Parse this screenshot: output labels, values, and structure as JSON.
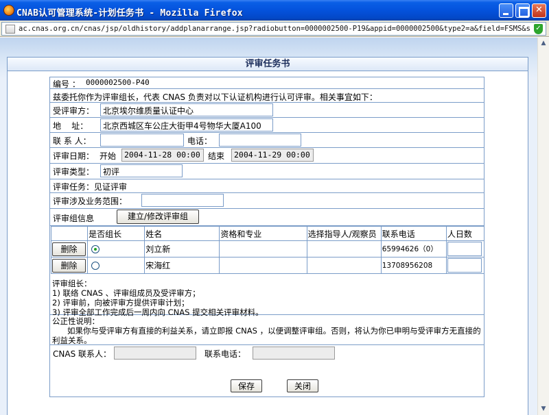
{
  "window": {
    "title": "CNAB认可管理系统-计划任务书 - Mozilla Firefox",
    "url": "ac.cnas.org.cn/cnas/jsp/oldhistory/addplanarrange.jsp?radiobutton=0000002500-P19&appid=0000002500&type2=a&field=FSMS&splitn"
  },
  "page": {
    "header": "评审任务书",
    "number_label": "编号 ：",
    "number_value": "0000002500-P40",
    "intro": "兹委托你作为评审组长，代表 CNAS 负责对以下认证机构进行认可评审。相关事宜如下：",
    "reviewee_label": "受评审方：",
    "reviewee_value": "北京埃尔维质量认证中心",
    "address_label": "地    址：",
    "address_value": "北京西城区车公庄大街甲4号物华大厦A100",
    "contact_label": "联 系 人：",
    "contact_value": "",
    "phone_label": "电话：",
    "phone_value": "",
    "date_label": "评审日期：",
    "start_label": "开始",
    "start_value": "2004-11-28 00:00",
    "end_label": "结束",
    "end_value": "2004-11-29 00:00",
    "type_label": "评审类型：",
    "type_value": "初评",
    "task_label": "评审任务：见证评审",
    "scope_label": "评审涉及业务范围：",
    "scope_value": "",
    "group_label": "评审组信息",
    "group_button": "建立/修改评审组",
    "members": {
      "headers": [
        "",
        "是否组长",
        "姓名",
        "资格和专业",
        "选择指导人/观察员",
        "联系电话",
        "人日数"
      ],
      "rows": [
        {
          "delete": "删除",
          "leader": true,
          "name": "刘立新",
          "qual": "",
          "guide": "",
          "phone": "65994626（0）",
          "days": ""
        },
        {
          "delete": "删除",
          "leader": false,
          "name": "宋海红",
          "qual": "",
          "guide": "",
          "phone": "13708956208",
          "days": ""
        }
      ]
    },
    "leader_notes": {
      "title": "评审组长：",
      "items": [
        "1) 联络 CNAS 、评审组成员及受评审方；",
        "2) 评审前，向被评审方提供评审计划；",
        "3) 评审全部工作完成后一周内向 CNAS 提交相关评审材料。"
      ]
    },
    "fairness": {
      "title": "公正性说明：",
      "text": "如果你与受评审方有直接的利益关系，请立即报 CNAS ，以便调整评审组。否则，将认为你已申明与受评审方无直接的利益关系。"
    },
    "cnas_contact_label": "CNAS 联系人：",
    "cnas_contact_value": "",
    "cnas_phone_label": "联系电话：",
    "cnas_phone_value": "",
    "save_button": "保存",
    "close_button": "关闭"
  }
}
